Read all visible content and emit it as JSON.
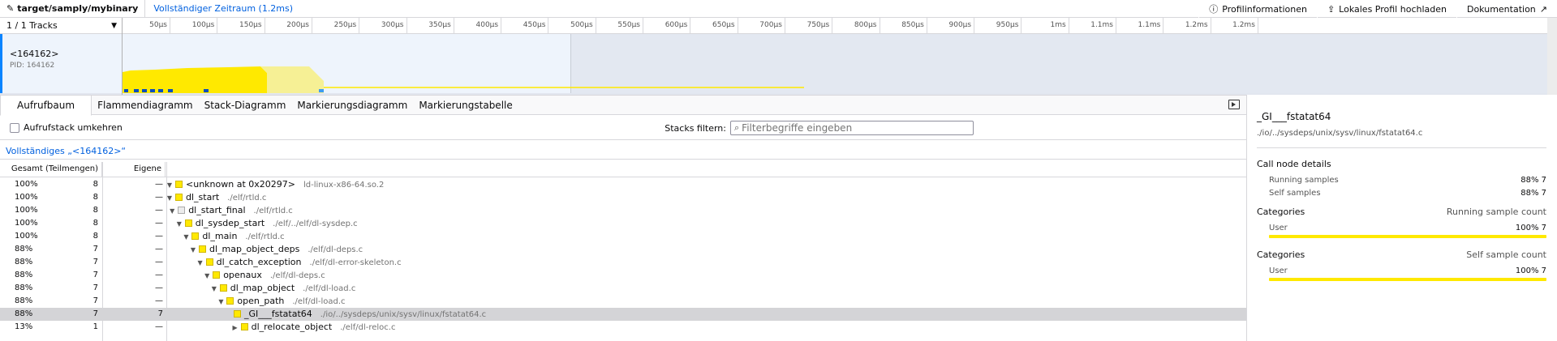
{
  "topbar": {
    "title": "target/samply/mybinary",
    "range": "Vollständiger Zeitraum (1.2ms)",
    "profile_info": "Profilinformationen",
    "upload": "Lokales Profil hochladen",
    "docs": "Dokumentation"
  },
  "timeline": {
    "tracks_count": "1 / 1 Tracks",
    "track_name": "<164162>",
    "track_pid": "PID: 164162",
    "ticks": [
      "50µs",
      "100µs",
      "150µs",
      "200µs",
      "250µs",
      "300µs",
      "350µs",
      "400µs",
      "450µs",
      "500µs",
      "550µs",
      "600µs",
      "650µs",
      "700µs",
      "750µs",
      "800µs",
      "850µs",
      "900µs",
      "950µs",
      "1ms",
      "1.1ms",
      "1.1ms",
      "1.2ms",
      "1.2ms"
    ],
    "colors": {
      "accent": "#0a84ff",
      "activity": "#ffe900",
      "activity_light": "#f6f095",
      "marker": "#0b4ebb"
    }
  },
  "tabs": [
    "Aufrufbaum",
    "Flammendiagramm",
    "Stack-Diagramm",
    "Markierungsdiagramm",
    "Markierungstabelle"
  ],
  "settings": {
    "invert_label": "Aufrufstack umkehren",
    "filter_label": "Stacks filtern:",
    "filter_placeholder": "Filterbegriffe eingeben"
  },
  "breadcrumb": "Vollständiges „<164162>“",
  "tree": {
    "headers": {
      "total": "Gesamt (Teilmengen)",
      "self": "Eigene"
    },
    "rows": [
      {
        "total": "100%",
        "count": "8",
        "self": "—",
        "name": "<unknown at 0x20297>",
        "lib": "ld-linux-x86-64.so.2",
        "toggle": "▼",
        "icon": "yellow"
      },
      {
        "total": "100%",
        "count": "8",
        "self": "—",
        "name": "dl_start",
        "lib": "./elf/rtld.c",
        "toggle": "▼",
        "icon": "yellow"
      },
      {
        "total": "100%",
        "count": "8",
        "self": "—",
        "name": "dl_start_final",
        "lib": "./elf/rtld.c",
        "toggle": "▼",
        "icon": "gray"
      },
      {
        "total": "100%",
        "count": "8",
        "self": "—",
        "name": "dl_sysdep_start",
        "lib": "./elf/../elf/dl-sysdep.c",
        "toggle": "▼",
        "icon": "yellow"
      },
      {
        "total": "100%",
        "count": "8",
        "self": "—",
        "name": "dl_main",
        "lib": "./elf/rtld.c",
        "toggle": "▼",
        "icon": "yellow"
      },
      {
        "total": "88%",
        "count": "7",
        "self": "—",
        "name": "dl_map_object_deps",
        "lib": "./elf/dl-deps.c",
        "toggle": "▼",
        "icon": "yellow"
      },
      {
        "total": "88%",
        "count": "7",
        "self": "—",
        "name": "dl_catch_exception",
        "lib": "./elf/dl-error-skeleton.c",
        "toggle": "▼",
        "icon": "yellow"
      },
      {
        "total": "88%",
        "count": "7",
        "self": "—",
        "name": "openaux",
        "lib": "./elf/dl-deps.c",
        "toggle": "▼",
        "icon": "yellow"
      },
      {
        "total": "88%",
        "count": "7",
        "self": "—",
        "name": "dl_map_object",
        "lib": "./elf/dl-load.c",
        "toggle": "▼",
        "icon": "yellow"
      },
      {
        "total": "88%",
        "count": "7",
        "self": "—",
        "name": "open_path",
        "lib": "./elf/dl-load.c",
        "toggle": "▼",
        "icon": "yellow"
      },
      {
        "total": "88%",
        "count": "7",
        "self": "7",
        "name": "_GI___fstatat64",
        "lib": "./io/../sysdeps/unix/sysv/linux/fstatat64.c",
        "toggle": "",
        "icon": "yellow"
      },
      {
        "total": "13%",
        "count": "1",
        "self": "—",
        "name": "dl_relocate_object",
        "lib": "./elf/dl-reloc.c",
        "toggle": "▶",
        "icon": "yellow"
      }
    ]
  },
  "sidebar": {
    "title": "_GI___fstatat64",
    "path": "./io/../sysdeps/unix/sysv/linux/fstatat64.c",
    "details_title": "Call node details",
    "running_label": "Running samples",
    "running_value": "88%  7",
    "self_label": "Self samples",
    "self_value": "88%  7",
    "cat1_title": "Categories",
    "cat1_right": "Running sample count",
    "cat1_name": "User",
    "cat1_value": "100%  7",
    "cat2_title": "Categories",
    "cat2_right": "Self sample count",
    "cat2_name": "User",
    "cat2_value": "100%  7"
  }
}
